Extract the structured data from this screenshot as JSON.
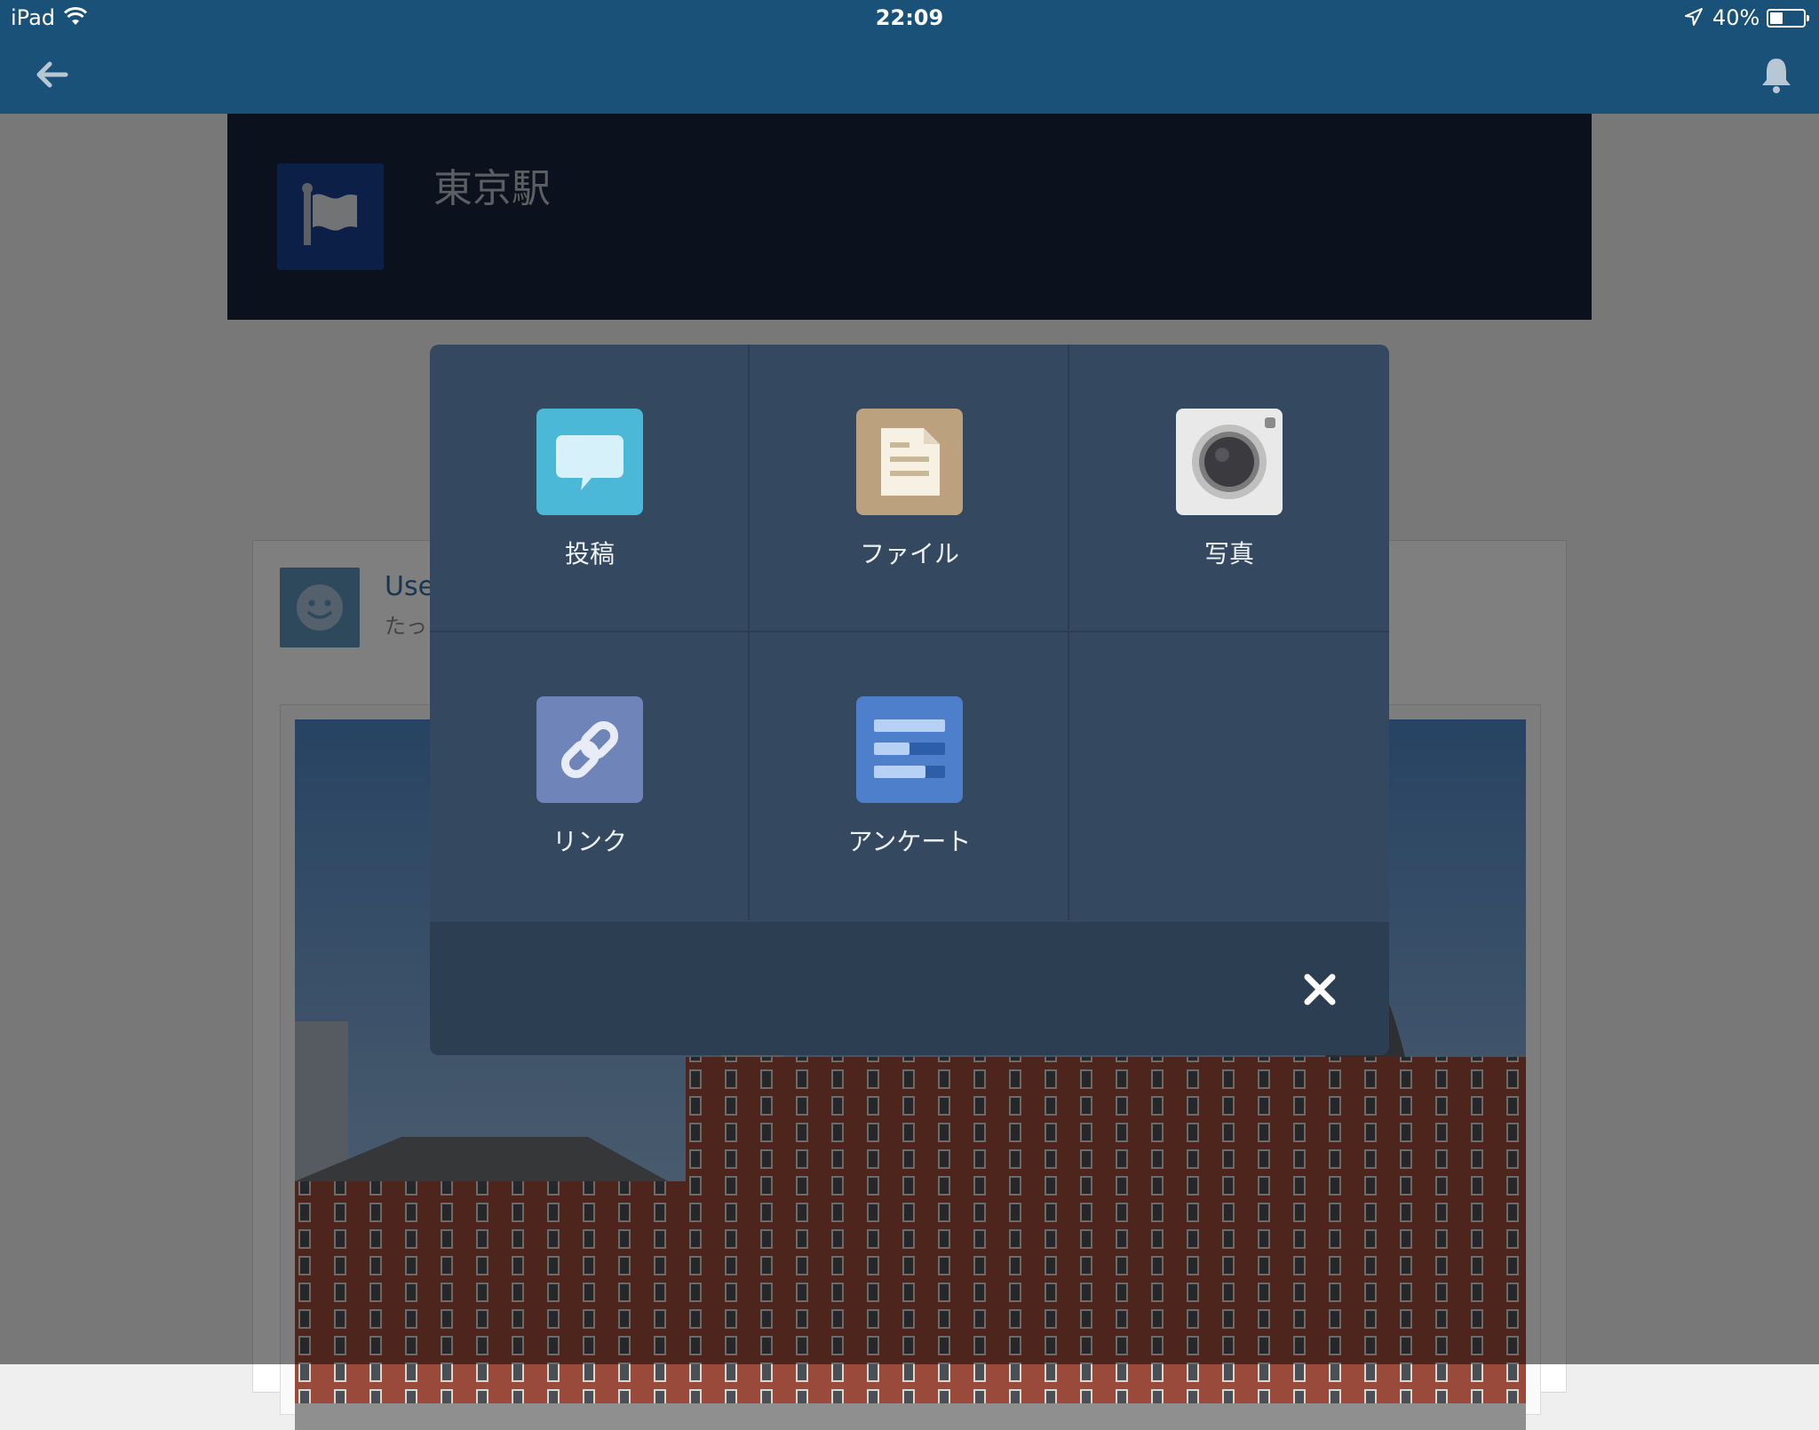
{
  "status_bar": {
    "carrier": "iPad",
    "time": "22:09",
    "battery": "40%",
    "battery_level": 0.4
  },
  "nav": {
    "back_icon": "arrow-left-icon",
    "notifications_icon": "bell-icon"
  },
  "group": {
    "title": "東京駅",
    "icon": "flag-icon"
  },
  "feed_item": {
    "user_name": "Use",
    "time": "たっ"
  },
  "action_sheet": {
    "items": [
      {
        "label": "投稿",
        "icon": "speech-bubble-icon",
        "color": "#4ab8d6"
      },
      {
        "label": "ファイル",
        "icon": "document-icon",
        "color": "#bba17d"
      },
      {
        "label": "写真",
        "icon": "camera-icon",
        "color": "#e9e9e9"
      },
      {
        "label": "リンク",
        "icon": "link-icon",
        "color": "#6f84b9"
      },
      {
        "label": "アンケート",
        "icon": "poll-icon",
        "color": "#4d7fcb"
      }
    ],
    "close_icon": "close-icon"
  },
  "colors": {
    "nav_bar": "#1a5178",
    "group_header": "#16243a",
    "sheet": "#34495f"
  }
}
